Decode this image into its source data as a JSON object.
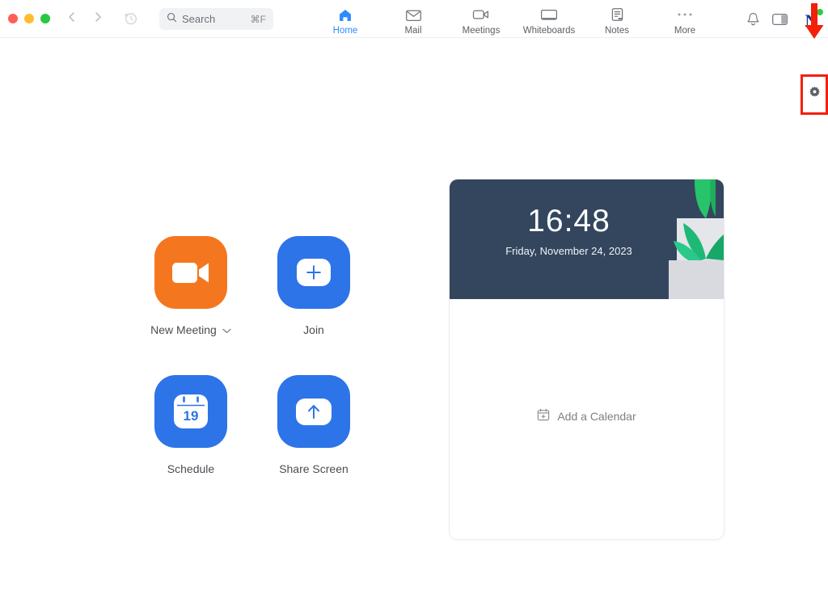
{
  "window": {
    "traffic_lights": [
      "close",
      "minimize",
      "maximize"
    ],
    "colors": {
      "accent_blue": "#2d8cff",
      "button_blue": "#2d74e8",
      "meeting_orange": "#f4771f",
      "card_navy": "#33465e",
      "annotation_red": "#f41f09",
      "presence_green": "#2ecc40"
    }
  },
  "search": {
    "placeholder": "Search",
    "shortcut": "⌘F",
    "icon": "search-icon"
  },
  "nav": {
    "back_icon": "chevron-left-icon",
    "forward_icon": "chevron-right-icon",
    "history_icon": "clock-history-icon",
    "tabs": [
      {
        "label": "Home",
        "icon": "home-icon",
        "active": true
      },
      {
        "label": "Mail",
        "icon": "mail-icon",
        "active": false
      },
      {
        "label": "Meetings",
        "icon": "video-camera-icon",
        "active": false
      },
      {
        "label": "Whiteboards",
        "icon": "monitor-icon",
        "active": false
      },
      {
        "label": "Notes",
        "icon": "note-icon",
        "active": false
      },
      {
        "label": "More",
        "icon": "ellipsis-icon",
        "active": false
      }
    ]
  },
  "header_right": {
    "notification_icon": "bell-icon",
    "panel_toggle_icon": "sidebar-panel-icon",
    "avatar_initial": "N",
    "avatar_status": "available"
  },
  "annotation": {
    "arrow_icon": "red-down-arrow",
    "highlight_target": "settings-gear-button",
    "settings_icon": "gear-icon"
  },
  "actions": [
    {
      "label": "New Meeting",
      "icon": "video-camera-icon",
      "color": "orange",
      "has_dropdown": true,
      "chevron": "⌄"
    },
    {
      "label": "Join",
      "icon": "plus-icon",
      "color": "blue",
      "has_dropdown": false
    },
    {
      "label": "Schedule",
      "icon": "calendar-icon",
      "color": "blue",
      "has_dropdown": false,
      "calendar_day": "19"
    },
    {
      "label": "Share Screen",
      "icon": "arrow-up-icon",
      "color": "blue",
      "has_dropdown": false
    }
  ],
  "calendar_card": {
    "time": "16:48",
    "date": "Friday, November 24, 2023",
    "empty_action": "Add a Calendar",
    "empty_action_icon": "calendar-plus-icon"
  }
}
